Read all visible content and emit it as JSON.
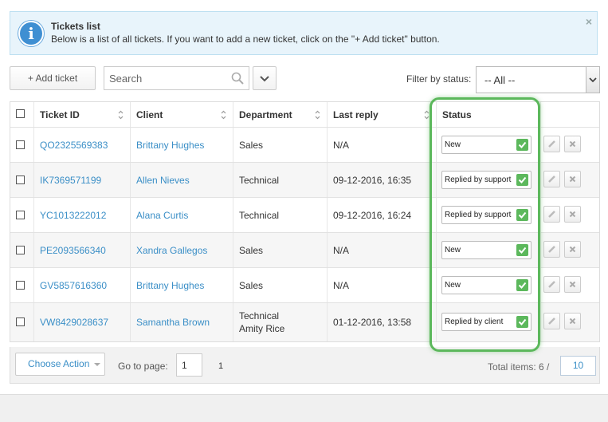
{
  "info": {
    "title": "Tickets list",
    "text": "Below is a list of all tickets. If you want to add a new ticket, click on the \"+ Add ticket\" button.",
    "close_glyph": "×"
  },
  "toolbar": {
    "add_label": "+ Add ticket",
    "search_placeholder": "Search",
    "filter_label": "Filter by status:",
    "filter_value": "-- All --"
  },
  "table": {
    "headers": {
      "ticket_id": "Ticket ID",
      "client": "Client",
      "department": "Department",
      "last_reply": "Last reply",
      "status": "Status"
    },
    "rows": [
      {
        "id": "QO2325569383",
        "client": "Brittany Hughes",
        "department": "Sales",
        "department2": "",
        "last_reply": "N/A",
        "status": "New"
      },
      {
        "id": "IK7369571199",
        "client": "Allen Nieves",
        "department": "Technical",
        "department2": "",
        "last_reply": "09-12-2016, 16:35",
        "status": "Replied by support"
      },
      {
        "id": "YC1013222012",
        "client": "Alana Curtis",
        "department": "Technical",
        "department2": "",
        "last_reply": "09-12-2016, 16:24",
        "status": "Replied by support"
      },
      {
        "id": "PE2093566340",
        "client": "Xandra Gallegos",
        "department": "Sales",
        "department2": "",
        "last_reply": "N/A",
        "status": "New"
      },
      {
        "id": "GV5857616360",
        "client": "Brittany Hughes",
        "department": "Sales",
        "department2": "",
        "last_reply": "N/A",
        "status": "New"
      },
      {
        "id": "VW8429028637",
        "client": "Samantha Brown",
        "department": "Technical",
        "department2": "Amity Rice",
        "last_reply": "01-12-2016, 13:58",
        "status": "Replied by client"
      }
    ]
  },
  "footer": {
    "choose_action": "Choose Action",
    "goto_label": "Go to page:",
    "page_value": "1",
    "page_number": "1",
    "total_label": "Total items: 6 /",
    "per_page": "10"
  },
  "colors": {
    "accent_link": "#3b8fc7",
    "highlight": "#5cb85c",
    "info_bg": "#e8f4fb"
  }
}
